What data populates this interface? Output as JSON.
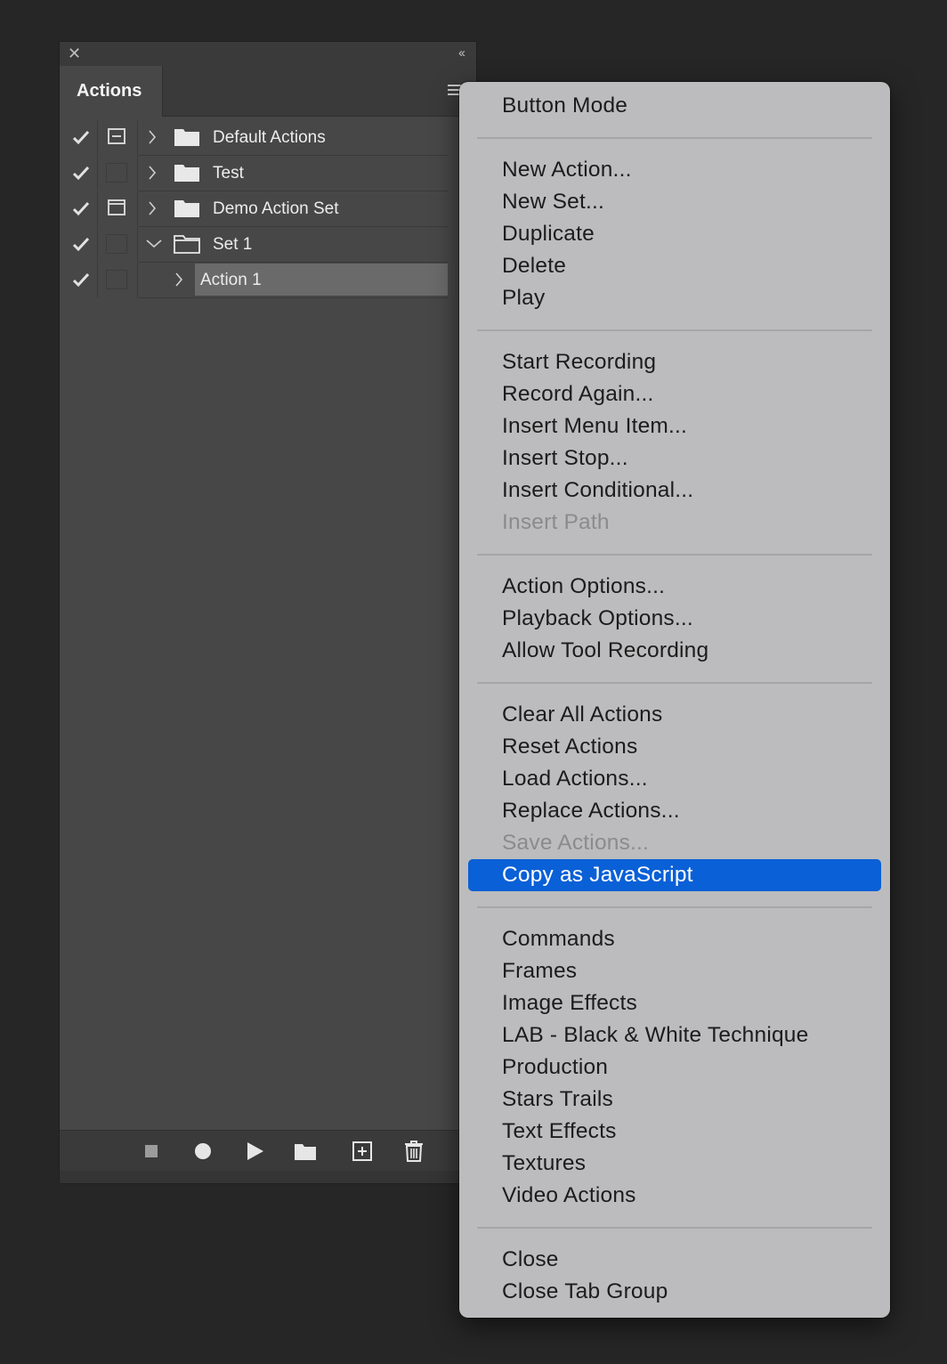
{
  "panel": {
    "tab_label": "Actions",
    "rows": [
      {
        "label": "Default Actions",
        "checked": true,
        "dialog": "minus",
        "expanded": false,
        "type": "set"
      },
      {
        "label": "Test",
        "checked": true,
        "dialog": "none",
        "expanded": false,
        "type": "set"
      },
      {
        "label": "Demo Action Set",
        "checked": true,
        "dialog": "box",
        "expanded": false,
        "type": "set"
      },
      {
        "label": "Set 1",
        "checked": true,
        "dialog": "none",
        "expanded": true,
        "type": "set"
      },
      {
        "label": "Action 1",
        "checked": true,
        "dialog": "none",
        "expanded": false,
        "type": "action",
        "selected": true
      }
    ],
    "bottom_buttons": [
      "stop-icon",
      "record-icon",
      "play-icon",
      "new-set-icon",
      "new-action-icon",
      "trash-icon"
    ]
  },
  "menu": {
    "groups": [
      [
        {
          "label": "Button Mode"
        }
      ],
      [
        {
          "label": "New Action..."
        },
        {
          "label": "New Set..."
        },
        {
          "label": "Duplicate"
        },
        {
          "label": "Delete"
        },
        {
          "label": "Play"
        }
      ],
      [
        {
          "label": "Start Recording"
        },
        {
          "label": "Record Again..."
        },
        {
          "label": "Insert Menu Item..."
        },
        {
          "label": "Insert Stop..."
        },
        {
          "label": "Insert Conditional..."
        },
        {
          "label": "Insert Path",
          "disabled": true
        }
      ],
      [
        {
          "label": "Action Options..."
        },
        {
          "label": "Playback Options..."
        },
        {
          "label": "Allow Tool Recording"
        }
      ],
      [
        {
          "label": "Clear All Actions"
        },
        {
          "label": "Reset Actions"
        },
        {
          "label": "Load Actions..."
        },
        {
          "label": "Replace Actions..."
        },
        {
          "label": "Save Actions...",
          "disabled": true
        },
        {
          "label": "Copy as JavaScript",
          "highlighted": true
        }
      ],
      [
        {
          "label": "Commands"
        },
        {
          "label": "Frames"
        },
        {
          "label": "Image Effects"
        },
        {
          "label": "LAB - Black & White Technique"
        },
        {
          "label": "Production"
        },
        {
          "label": "Stars Trails"
        },
        {
          "label": "Text Effects"
        },
        {
          "label": "Textures"
        },
        {
          "label": "Video Actions"
        }
      ],
      [
        {
          "label": "Close"
        },
        {
          "label": "Close Tab Group"
        }
      ]
    ]
  },
  "colors": {
    "highlight": "#0a60d6",
    "menu_bg": "#bcbcbe",
    "panel_bg": "#474747",
    "page_bg": "#262626"
  }
}
